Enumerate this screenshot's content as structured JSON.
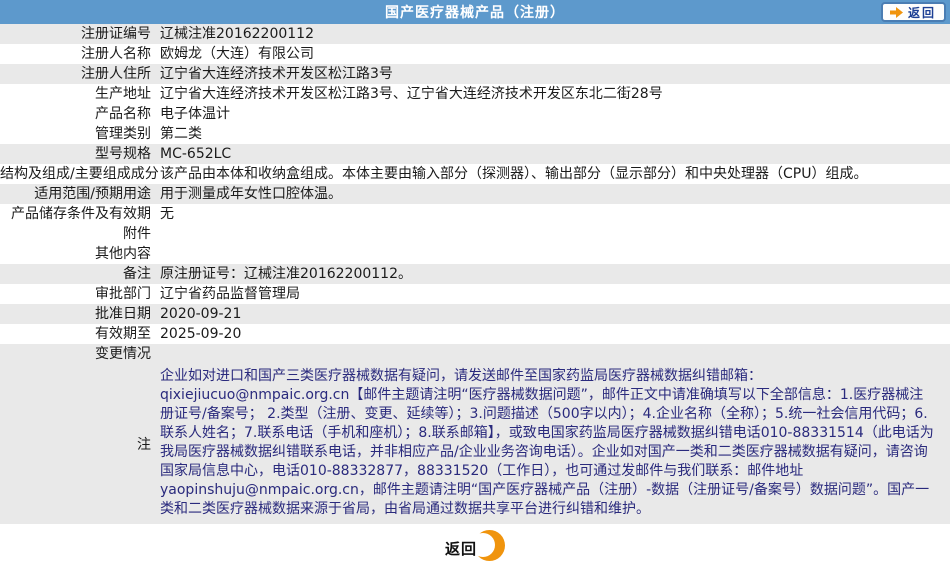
{
  "header": {
    "title": "国产医疗器械产品（注册）",
    "return_label": "返回"
  },
  "colors": {
    "header_bg": "#5d99cc",
    "row_shaded_bg": "#e9e9e9",
    "accent_orange": "#f0940d",
    "return_text_navy": "#1c3f94",
    "note_text_navy": "#2a2a7d"
  },
  "rows": [
    {
      "label": "注册证编号",
      "value": "辽械注准20162200112"
    },
    {
      "label": "注册人名称",
      "value": "欧姆龙（大连）有限公司"
    },
    {
      "label": "注册人住所",
      "value": "辽宁省大连经济技术开发区松江路3号"
    },
    {
      "label": "生产地址",
      "value": "辽宁省大连经济技术开发区松江路3号、辽宁省大连经济技术开发区东北二街28号"
    },
    {
      "label": "产品名称",
      "value": "电子体温计"
    },
    {
      "label": "管理类别",
      "value": "第二类"
    },
    {
      "label": "型号规格",
      "value": "MC-652LC"
    },
    {
      "label": "结构及组成/主要组成成分",
      "value": "该产品由本体和收纳盒组成。本体主要由输入部分（探测器）、输出部分（显示部分）和中央处理器（CPU）组成。"
    },
    {
      "label": "适用范围/预期用途",
      "value": "用于测量成年女性口腔体温。"
    },
    {
      "label": "产品储存条件及有效期",
      "value": "无"
    },
    {
      "label": "附件",
      "value": ""
    },
    {
      "label": "其他内容",
      "value": ""
    },
    {
      "label": "备注",
      "value": "原注册证号：辽械注准20162200112。"
    },
    {
      "label": "审批部门",
      "value": "辽宁省药品监督管理局"
    },
    {
      "label": "批准日期",
      "value": "2020-09-21"
    },
    {
      "label": "有效期至",
      "value": "2025-09-20"
    },
    {
      "label": "变更情况",
      "value": ""
    }
  ],
  "note": {
    "label": "注",
    "text": "企业如对进口和国产三类医疗器械数据有疑问，请发送邮件至国家药监局医疗器械数据纠错邮箱：qixiejiucuo@nmpaic.org.cn【邮件主题请注明“医疗器械数据问题”，邮件正文中请准确填写以下全部信息：1.医疗器械注册证号/备案号； 2.类型（注册、变更、延续等）；3.问题描述（500字以内）；4.企业名称（全称）；5.统一社会信用代码；6.联系人姓名；7.联系电话（手机和座机）；8.联系邮箱】，或致电国家药监局医疗器械数据纠错电话010-88331514（此电话为我局医疗器械数据纠错联系电话，并非相应产品/企业业务咨询电话）。企业如对国产一类和二类医疗器械数据有疑问，请咨询国家局信息中心，电话010-88332877，88331520（工作日），也可通过发邮件与我们联系：邮件地址yaopinshuju@nmpaic.org.cn，邮件主题请注明“国产医疗器械产品（注册）-数据（注册证号/备案号）数据问题”。国产一类和二类医疗器械数据来源于省局，由省局通过数据共享平台进行纠错和维护。"
  },
  "footer": {
    "return_label": "返回"
  }
}
